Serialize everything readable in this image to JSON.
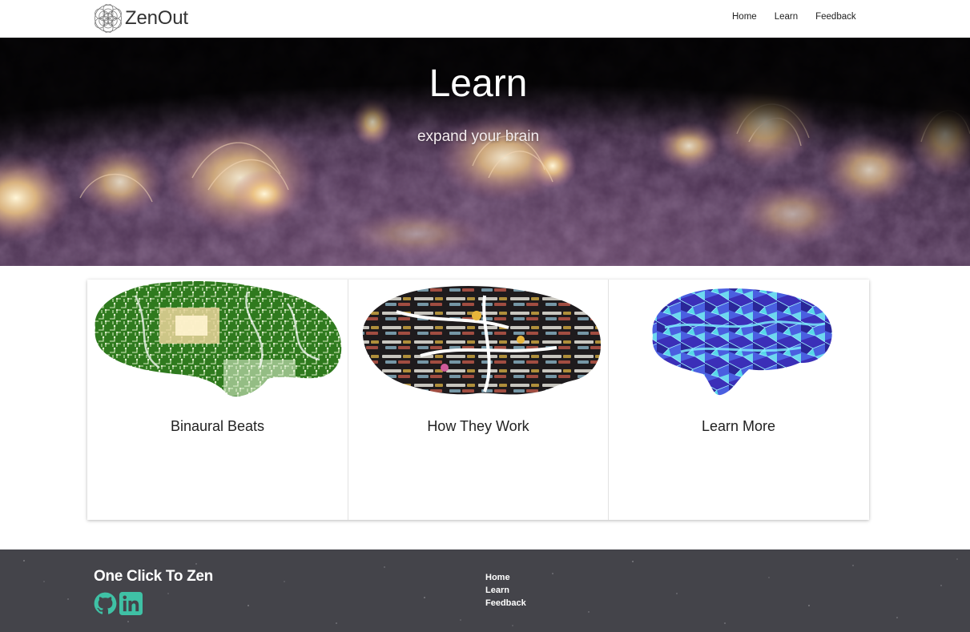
{
  "brand": {
    "name": "ZenOut",
    "logo_icon": "flower-of-life-icon"
  },
  "nav": {
    "links": [
      "Home",
      "Learn",
      "Feedback"
    ]
  },
  "hero": {
    "title": "Learn",
    "subtitle": "expand your brain"
  },
  "cards": [
    {
      "title": "Binaural Beats",
      "image": "circuit-brain-illustration"
    },
    {
      "title": "How They Work",
      "image": "word-cloud-brain-illustration"
    },
    {
      "title": "Learn More",
      "image": "stained-glass-brain-illustration"
    }
  ],
  "footer": {
    "title": "One Click To Zen",
    "social": [
      "github-icon",
      "linkedin-icon"
    ],
    "links": [
      "Home",
      "Learn",
      "Feedback"
    ],
    "accent_color": "#3fc1a5",
    "background_color": "#44444a"
  }
}
